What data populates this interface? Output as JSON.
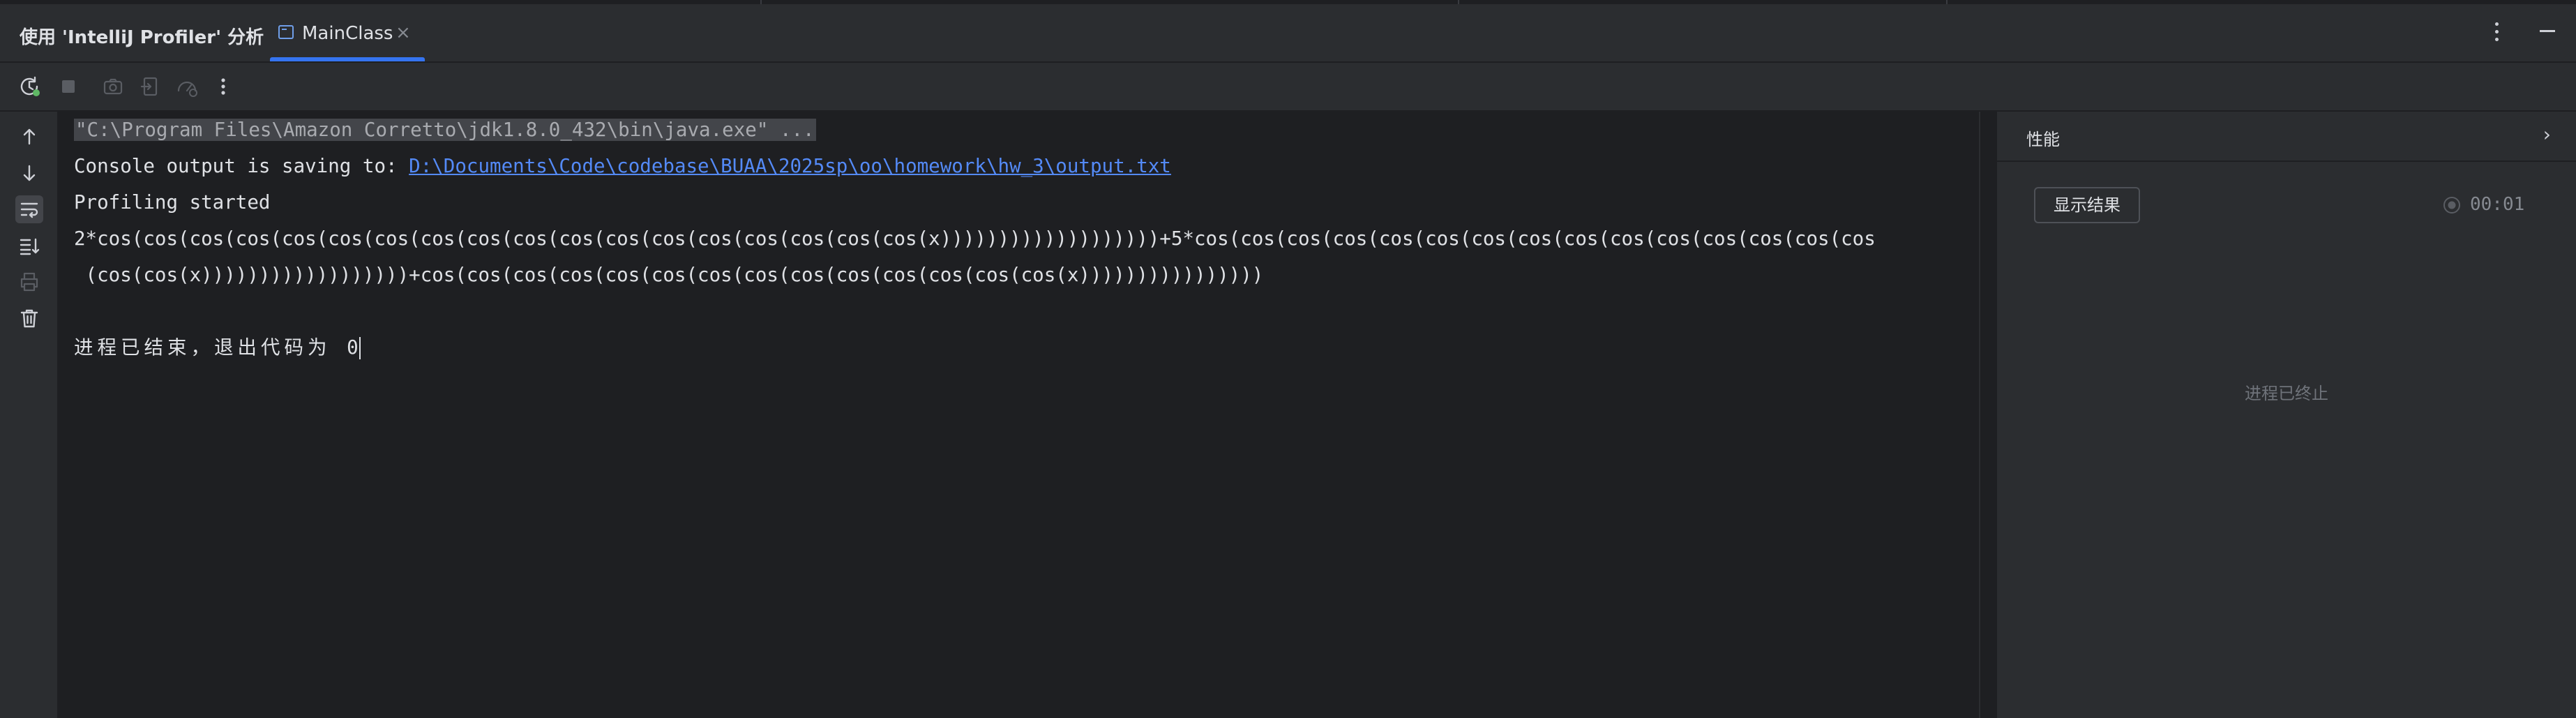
{
  "window": {
    "tool_title": "使用 'IntelliJ Profiler' 分析",
    "tab_label": "MainClass",
    "tab_icon": "console-window-icon",
    "tab_close": "×"
  },
  "toolbar": {
    "buttons": [
      "rerun-profiler-icon",
      "stop-icon",
      "screenshot-icon",
      "exit-icon",
      "performance-gauge-icon",
      "more-options-icon"
    ]
  },
  "gutter": {
    "buttons": [
      "arrow-up-icon",
      "arrow-down-icon",
      "soft-wrap-icon",
      "scroll-to-end-icon",
      "print-icon",
      "trash-icon"
    ]
  },
  "console": {
    "command": "\"C:\\Program Files\\Amazon Corretto\\jdk1.8.0_432\\bin\\java.exe\" ...",
    "saving_prefix": "Console output is saving to: ",
    "saving_path": "D:\\Documents\\Code\\codebase\\BUAA\\2025sp\\oo\\homework\\hw_3\\output.txt",
    "profiling": "Profiling started",
    "output_line1": "2*cos(cos(cos(cos(cos(cos(cos(cos(cos(cos(cos(cos(cos(cos(cos(cos(cos(cos(x)))))))))))))))))))+5*cos(cos(cos(cos(cos(cos(cos(cos(cos(cos(cos(cos(cos(cos(cos",
    "output_line2": " (cos(cos(x))))))))))))))))))+cos(cos(cos(cos(cos(cos(cos(cos(cos(cos(cos(cos(cos(cos(x))))))))))))))))",
    "exit_text": "进程已结束，退出代码为 ",
    "exit_code": "0"
  },
  "panel": {
    "title": "性能",
    "show_results": "显示结果",
    "timer": "00:01",
    "terminated": "进程已终止"
  },
  "colors": {
    "accent": "#3574f0",
    "link": "#548af7",
    "console_bg": "#1e1f22",
    "panel_bg": "#2b2d30"
  }
}
